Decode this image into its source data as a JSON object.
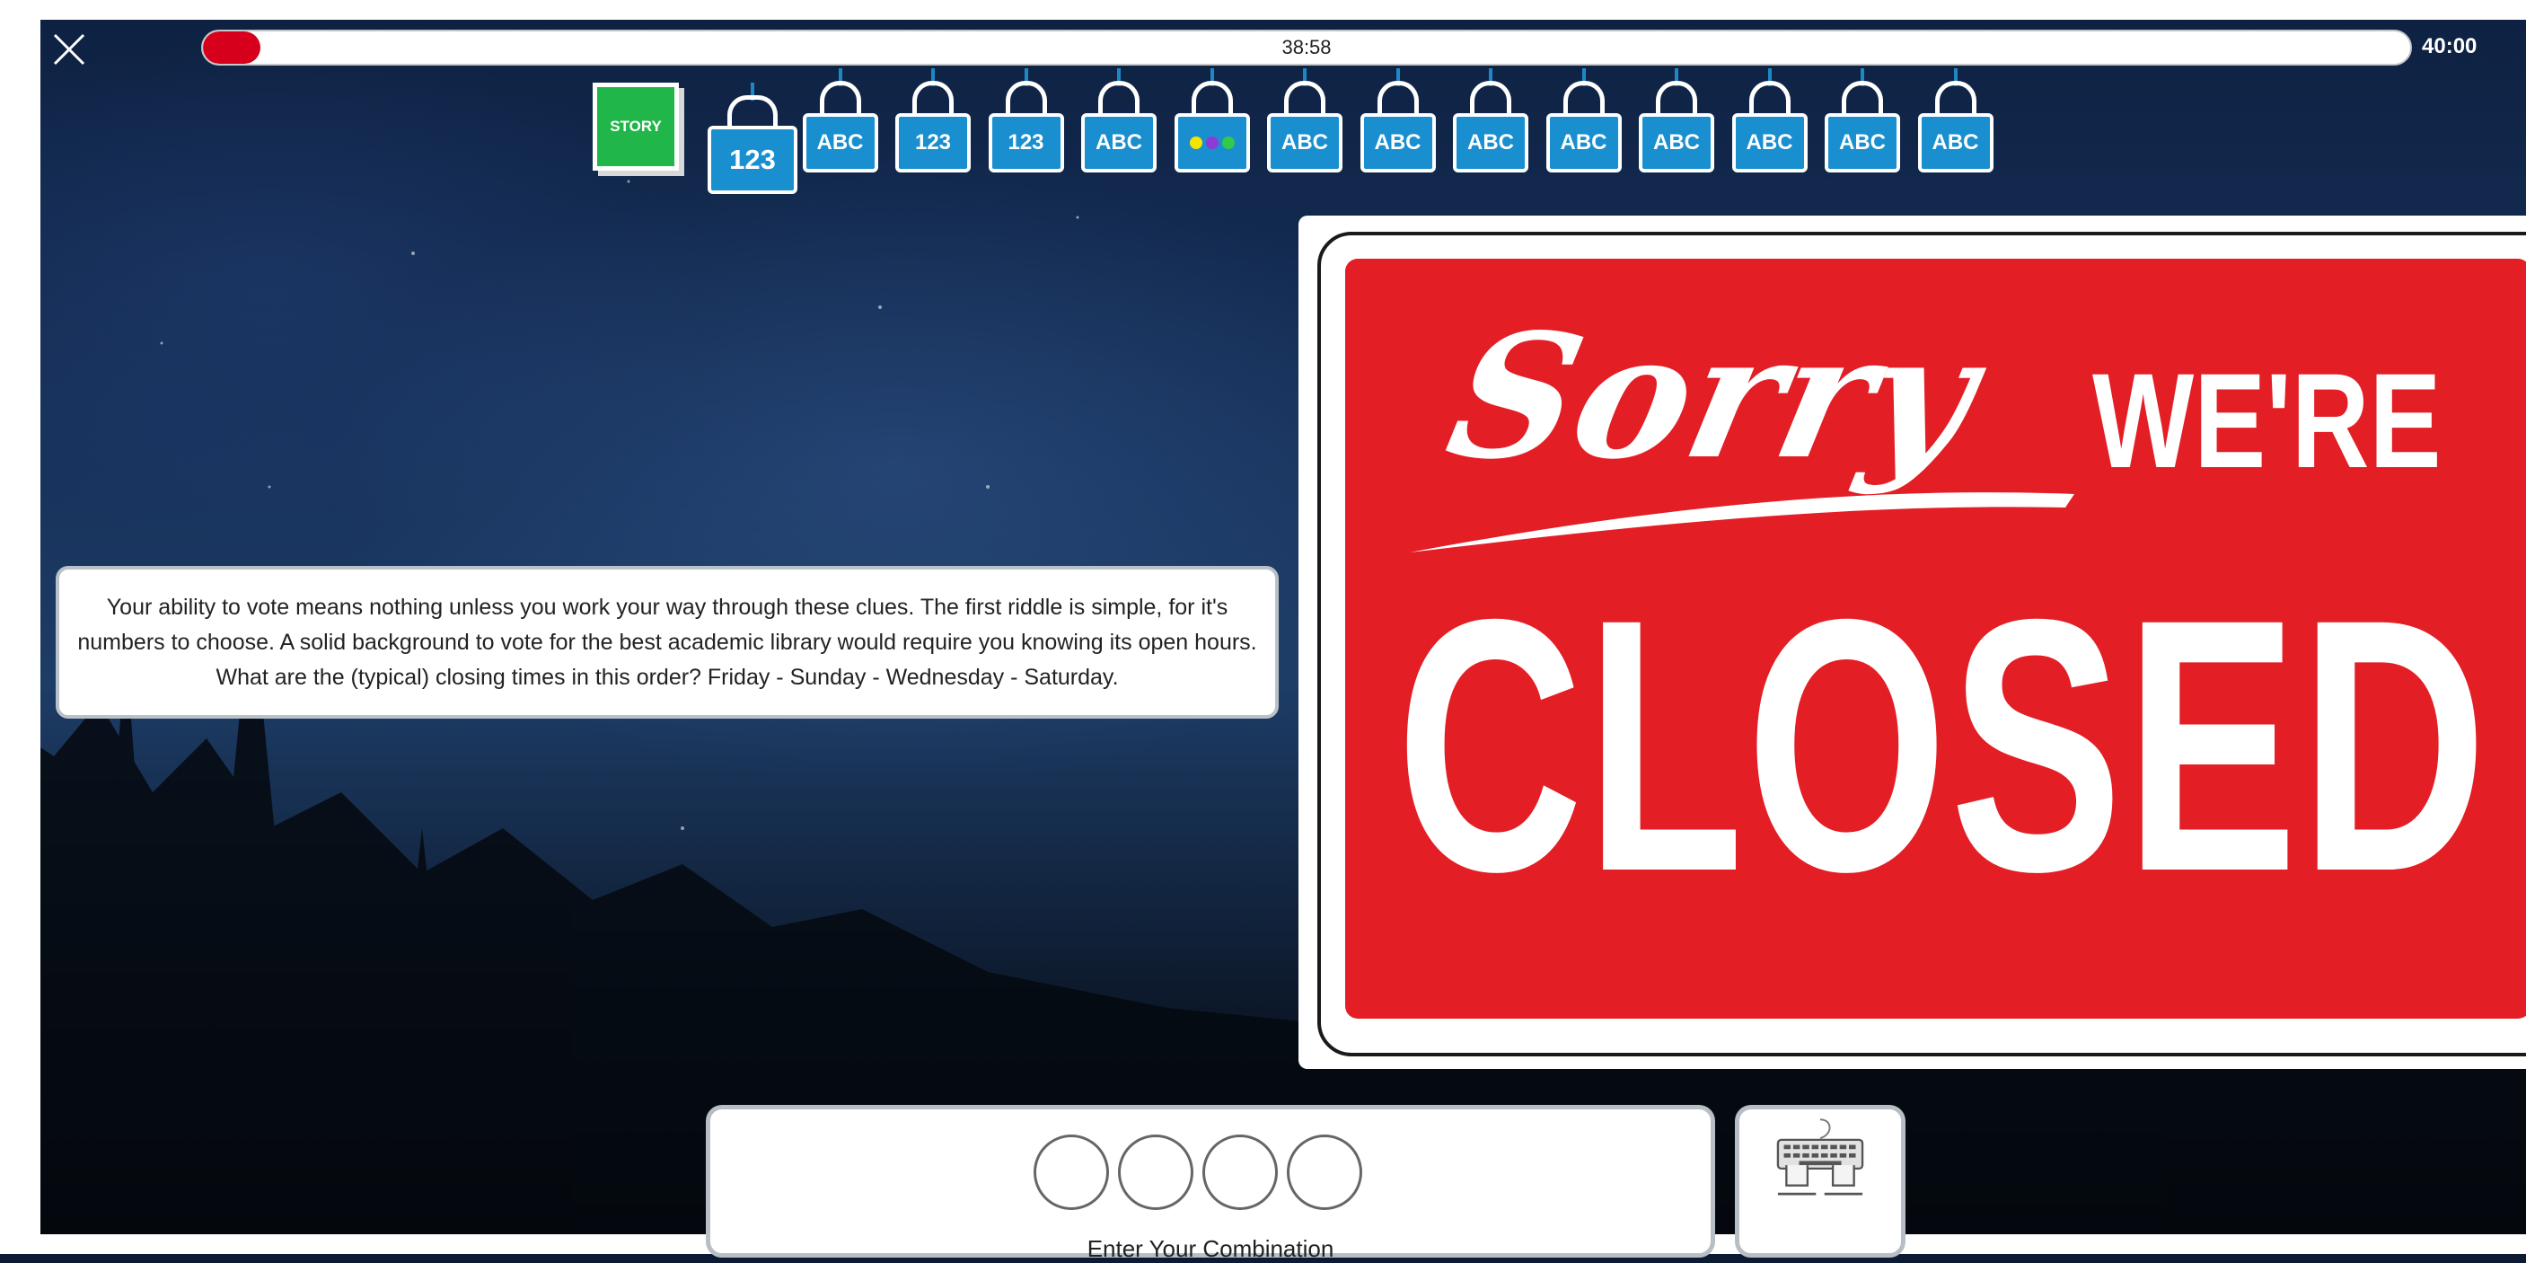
{
  "timer": {
    "elapsed": "38:58",
    "total": "40:00",
    "progress_fraction": 0.026
  },
  "story_label": "STORY",
  "locks": [
    {
      "type": "123",
      "selected": true
    },
    {
      "type": "ABC"
    },
    {
      "type": "123"
    },
    {
      "type": "123"
    },
    {
      "type": "ABC"
    },
    {
      "type": "colors",
      "colors": [
        "#f5e400",
        "#8e3bd6",
        "#33c94a"
      ]
    },
    {
      "type": "ABC"
    },
    {
      "type": "ABC"
    },
    {
      "type": "ABC"
    },
    {
      "type": "ABC"
    },
    {
      "type": "ABC"
    },
    {
      "type": "ABC"
    },
    {
      "type": "ABC"
    },
    {
      "type": "ABC"
    }
  ],
  "clue": "Your ability to vote means nothing unless you work your way through these clues. The first riddle is simple, for it's numbers to choose. A solid background to vote for the best academic library would require you knowing its open hours. What are the (typical) closing times in this order? Friday - Sunday - Wednesday - Saturday.",
  "sign": {
    "line1_script": "Sorry",
    "line1_bold": "WE'RE",
    "line2": "CLOSED"
  },
  "combination": {
    "label": "Enter Your Combination",
    "slots": [
      "",
      "",
      "",
      ""
    ]
  },
  "icons": {
    "close": "close-icon",
    "keyboard": "keyboard-icon"
  }
}
